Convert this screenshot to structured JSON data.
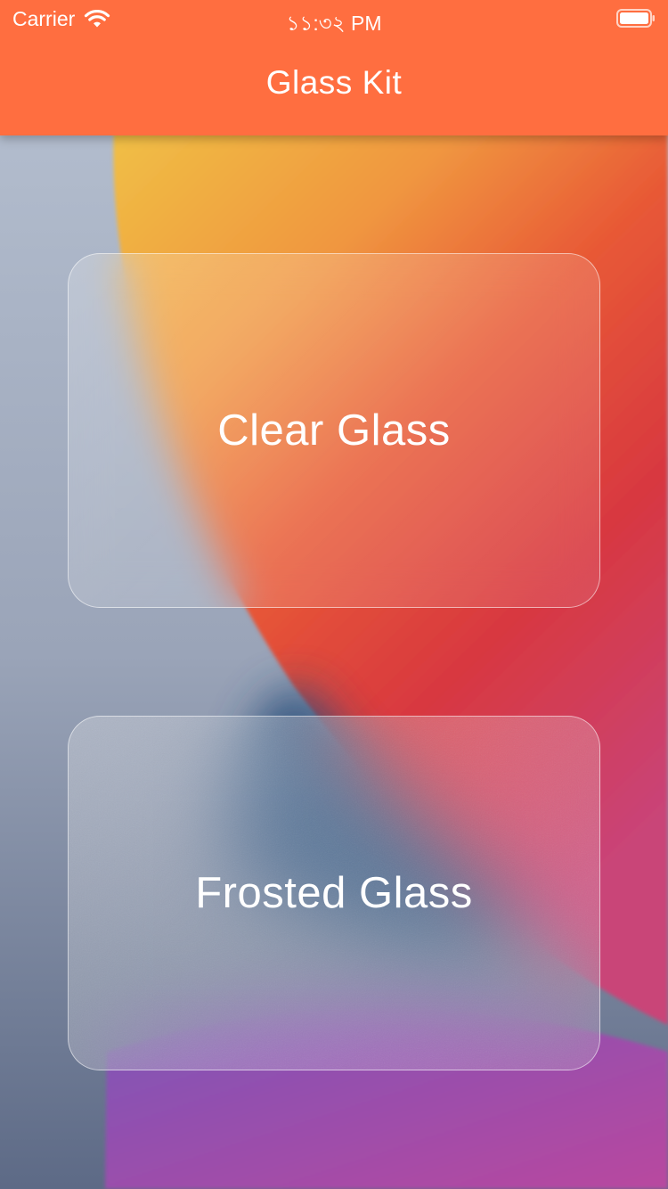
{
  "status_bar": {
    "carrier": "Carrier",
    "time": "১১:৩২ PM",
    "wifi_icon": "wifi-icon",
    "battery_icon": "battery-icon"
  },
  "app_bar": {
    "title": "Glass Kit",
    "color": "#ff6e40"
  },
  "cards": [
    {
      "label": "Clear Glass",
      "style": "clear"
    },
    {
      "label": "Frosted Glass",
      "style": "frosted"
    }
  ],
  "wallpaper": {
    "colors": [
      "#b3bccd",
      "#f0b83a",
      "#ee5a33",
      "#d63a3e",
      "#1c4a75",
      "#9d4fb5"
    ]
  }
}
